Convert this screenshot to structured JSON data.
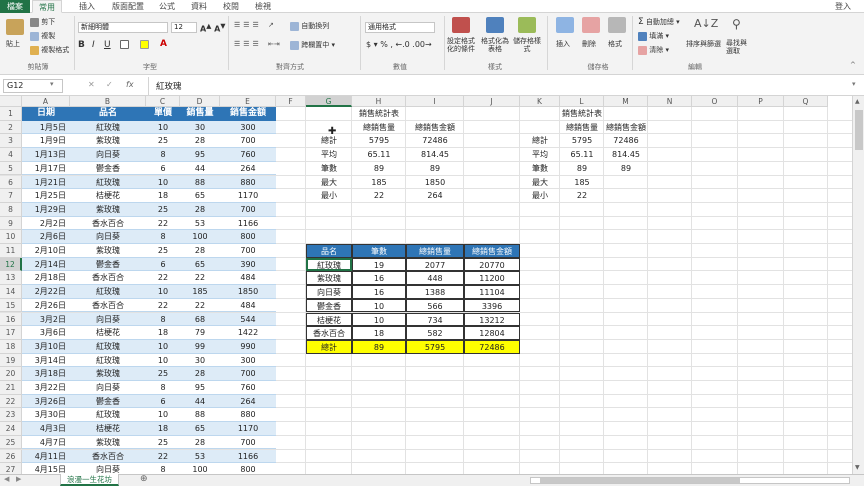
{
  "tabs": [
    {
      "label": "檔案"
    },
    {
      "label": "常用"
    },
    {
      "label": "插入"
    },
    {
      "label": "版面配置"
    },
    {
      "label": "公式"
    },
    {
      "label": "資料"
    },
    {
      "label": "校閱"
    },
    {
      "label": "檢視"
    }
  ],
  "user": "登入",
  "ribbon": {
    "paste": "貼上",
    "cut": "剪下",
    "copy": "複製",
    "format_painter": "複製格式",
    "clipboard": "剪貼簿",
    "font_name": "新細明體",
    "font_size": "12",
    "font": "字型",
    "wrap": "自動換列",
    "merge": "跨欄置中",
    "alignment": "對齊方式",
    "number_format": "通用格式",
    "number": "數值",
    "cond_format": "設定格式化的條件",
    "format_table": "格式化為表格",
    "cell_styles": "儲存格樣式",
    "styles": "樣式",
    "insert": "插入",
    "delete": "刪除",
    "format": "格式",
    "cells": "儲存格",
    "autosum": "自動加總",
    "fill": "填滿",
    "clear": "清除",
    "sort": "排序與篩選",
    "find": "尋找與選取",
    "editing": "編輯"
  },
  "formula_bar": {
    "name_box": "G12",
    "fx": "fx",
    "value": "紅玫瑰"
  },
  "columns": [
    "A",
    "B",
    "C",
    "D",
    "E",
    "F",
    "G",
    "H",
    "I",
    "J",
    "K",
    "L",
    "M",
    "N",
    "O",
    "P",
    "Q"
  ],
  "rows": [
    "1",
    "2",
    "3",
    "4",
    "5",
    "6",
    "7",
    "8",
    "9",
    "10",
    "11",
    "12",
    "13",
    "14",
    "15",
    "16",
    "17",
    "18",
    "19",
    "20",
    "21",
    "22",
    "23",
    "24",
    "25",
    "26",
    "27"
  ],
  "main_table": {
    "headers": [
      "日期",
      "品名",
      "單價",
      "銷售量",
      "銷售金額"
    ],
    "rows": [
      [
        "1月5日",
        "紅玫瑰",
        "10",
        "30",
        "300"
      ],
      [
        "1月9日",
        "紫玫瑰",
        "25",
        "28",
        "700"
      ],
      [
        "1月13日",
        "向日葵",
        "8",
        "95",
        "760"
      ],
      [
        "1月17日",
        "鬱金香",
        "6",
        "44",
        "264"
      ],
      [
        "1月21日",
        "紅玫瑰",
        "10",
        "88",
        "880"
      ],
      [
        "1月25日",
        "桔梗花",
        "18",
        "65",
        "1170"
      ],
      [
        "1月29日",
        "紫玫瑰",
        "25",
        "28",
        "700"
      ],
      [
        "2月2日",
        "香水百合",
        "22",
        "53",
        "1166"
      ],
      [
        "2月6日",
        "向日葵",
        "8",
        "100",
        "800"
      ],
      [
        "2月10日",
        "紫玫瑰",
        "25",
        "28",
        "700"
      ],
      [
        "2月14日",
        "鬱金香",
        "6",
        "65",
        "390"
      ],
      [
        "2月18日",
        "香水百合",
        "22",
        "22",
        "484"
      ],
      [
        "2月22日",
        "紅玫瑰",
        "10",
        "185",
        "1850"
      ],
      [
        "2月26日",
        "香水百合",
        "22",
        "22",
        "484"
      ],
      [
        "3月2日",
        "向日葵",
        "8",
        "68",
        "544"
      ],
      [
        "3月6日",
        "桔梗花",
        "18",
        "79",
        "1422"
      ],
      [
        "3月10日",
        "紅玫瑰",
        "10",
        "99",
        "990"
      ],
      [
        "3月14日",
        "紅玫瑰",
        "10",
        "30",
        "300"
      ],
      [
        "3月18日",
        "紫玫瑰",
        "25",
        "28",
        "700"
      ],
      [
        "3月22日",
        "向日葵",
        "8",
        "95",
        "760"
      ],
      [
        "3月26日",
        "鬱金香",
        "6",
        "44",
        "264"
      ],
      [
        "3月30日",
        "紅玫瑰",
        "10",
        "88",
        "880"
      ],
      [
        "4月3日",
        "桔梗花",
        "18",
        "65",
        "1170"
      ],
      [
        "4月7日",
        "紫玫瑰",
        "25",
        "28",
        "700"
      ],
      [
        "4月11日",
        "香水百合",
        "22",
        "53",
        "1166"
      ],
      [
        "4月15日",
        "向日葵",
        "8",
        "100",
        "800"
      ]
    ]
  },
  "stats1": {
    "title": "銷售統計表",
    "col1": "總銷售量",
    "col2": "總銷售金額",
    "rows": [
      [
        "總計",
        "5795",
        "72486"
      ],
      [
        "平均",
        "65.11",
        "814.45"
      ],
      [
        "筆數",
        "89",
        "89"
      ],
      [
        "最大",
        "185",
        "1850"
      ],
      [
        "最小",
        "22",
        "264"
      ]
    ]
  },
  "stats2": {
    "title": "銷售統計表",
    "col1": "總銷售量",
    "col2": "總銷售金額",
    "rows": [
      [
        "總計",
        "5795",
        "72486"
      ],
      [
        "平均",
        "65.11",
        "814.45"
      ],
      [
        "筆數",
        "89",
        "89"
      ],
      [
        "最大",
        "185",
        ""
      ],
      [
        "最小",
        "22",
        ""
      ]
    ]
  },
  "summary_table": {
    "headers": [
      "品名",
      "筆數",
      "總銷售量",
      "總銷售金額"
    ],
    "rows": [
      [
        "紅玫瑰",
        "19",
        "2077",
        "20770"
      ],
      [
        "紫玫瑰",
        "16",
        "448",
        "11200"
      ],
      [
        "向日葵",
        "16",
        "1388",
        "11104"
      ],
      [
        "鬱金香",
        "10",
        "566",
        "3396"
      ],
      [
        "桔梗花",
        "10",
        "734",
        "13212"
      ],
      [
        "香水百合",
        "18",
        "582",
        "12804"
      ]
    ],
    "total": [
      "總計",
      "89",
      "5795",
      "72486"
    ]
  },
  "sheet": {
    "name": "浪漫一生花坊"
  },
  "colors": {
    "accent": "#217346",
    "header_blue": "#2e75b6",
    "row_light": "#ddebf7",
    "total_yellow": "#ffff00"
  }
}
